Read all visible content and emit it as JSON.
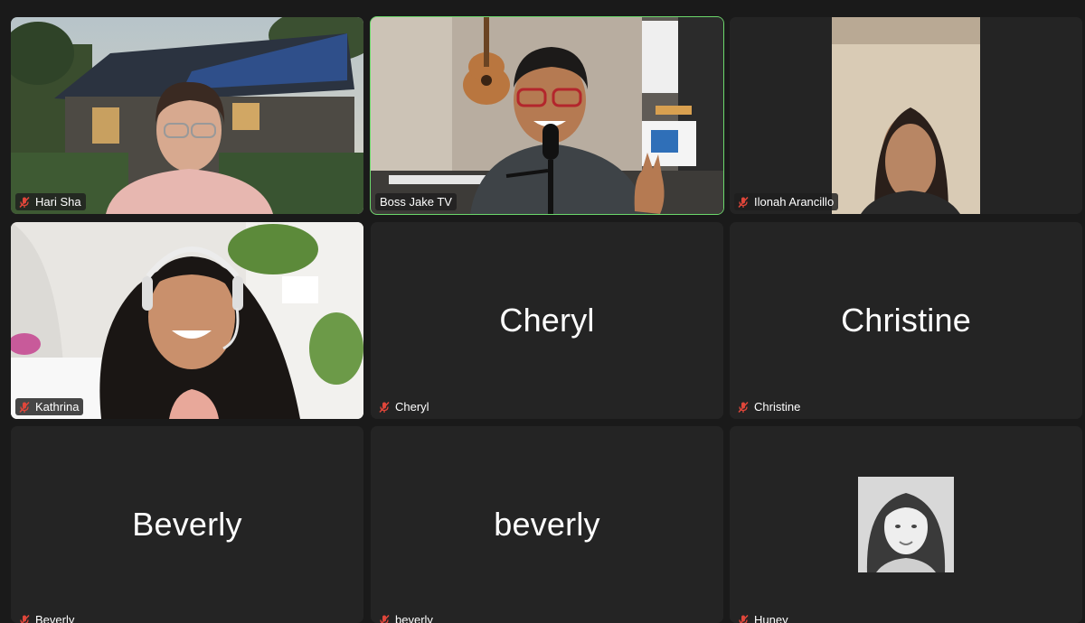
{
  "tiles": [
    {
      "id": "hari",
      "name": "Hari Sha",
      "muted": true,
      "video": true
    },
    {
      "id": "jake",
      "name": "Boss Jake TV",
      "muted": false,
      "video": true,
      "active_speaker": true
    },
    {
      "id": "ilonah",
      "name": "Ilonah Arancillo",
      "muted": true,
      "video": true
    },
    {
      "id": "kathrina",
      "name": "Kathrina",
      "muted": true,
      "video": true
    },
    {
      "id": "cheryl",
      "name": "Cheryl",
      "center_label": "Cheryl",
      "muted": true,
      "video": false
    },
    {
      "id": "christine",
      "name": "Christine",
      "center_label": "Christine",
      "muted": true,
      "video": false
    },
    {
      "id": "beverly1",
      "name": "Beverly",
      "center_label": "Beverly",
      "muted": true,
      "video": false
    },
    {
      "id": "beverly2",
      "name": "beverly",
      "center_label": "beverly",
      "muted": true,
      "video": false
    },
    {
      "id": "huney",
      "name": "Huney",
      "muted": true,
      "video": false,
      "has_avatar": true
    }
  ],
  "colors": {
    "active_border": "#6bd86b",
    "tile_bg": "#242424",
    "muted_icon": "#e0463a"
  }
}
